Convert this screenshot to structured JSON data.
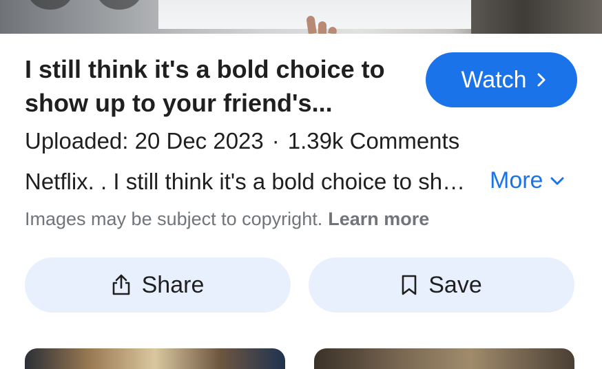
{
  "result": {
    "title": "I still think it's a bold choice to show up to your friend's...",
    "watch_label": "Watch",
    "uploaded": "Uploaded: 20 Dec 2023",
    "separator": "·",
    "comments": "1.39k Comments",
    "description": "Netflix. . I still think it's a bold choice to show up to your friend's...",
    "more_label": "More",
    "copyright_text": "Images may be subject to copyright.",
    "learn_more_label": "Learn more",
    "share_label": "Share",
    "save_label": "Save"
  },
  "icons": {
    "watch": "chevron-right-icon",
    "more": "chevron-down-icon",
    "share": "share-icon",
    "save": "bookmark-icon"
  },
  "colors": {
    "accent": "#1a73e8",
    "button_bg": "#e8f0fe",
    "text": "#1f1f1f",
    "muted": "#70757a"
  }
}
